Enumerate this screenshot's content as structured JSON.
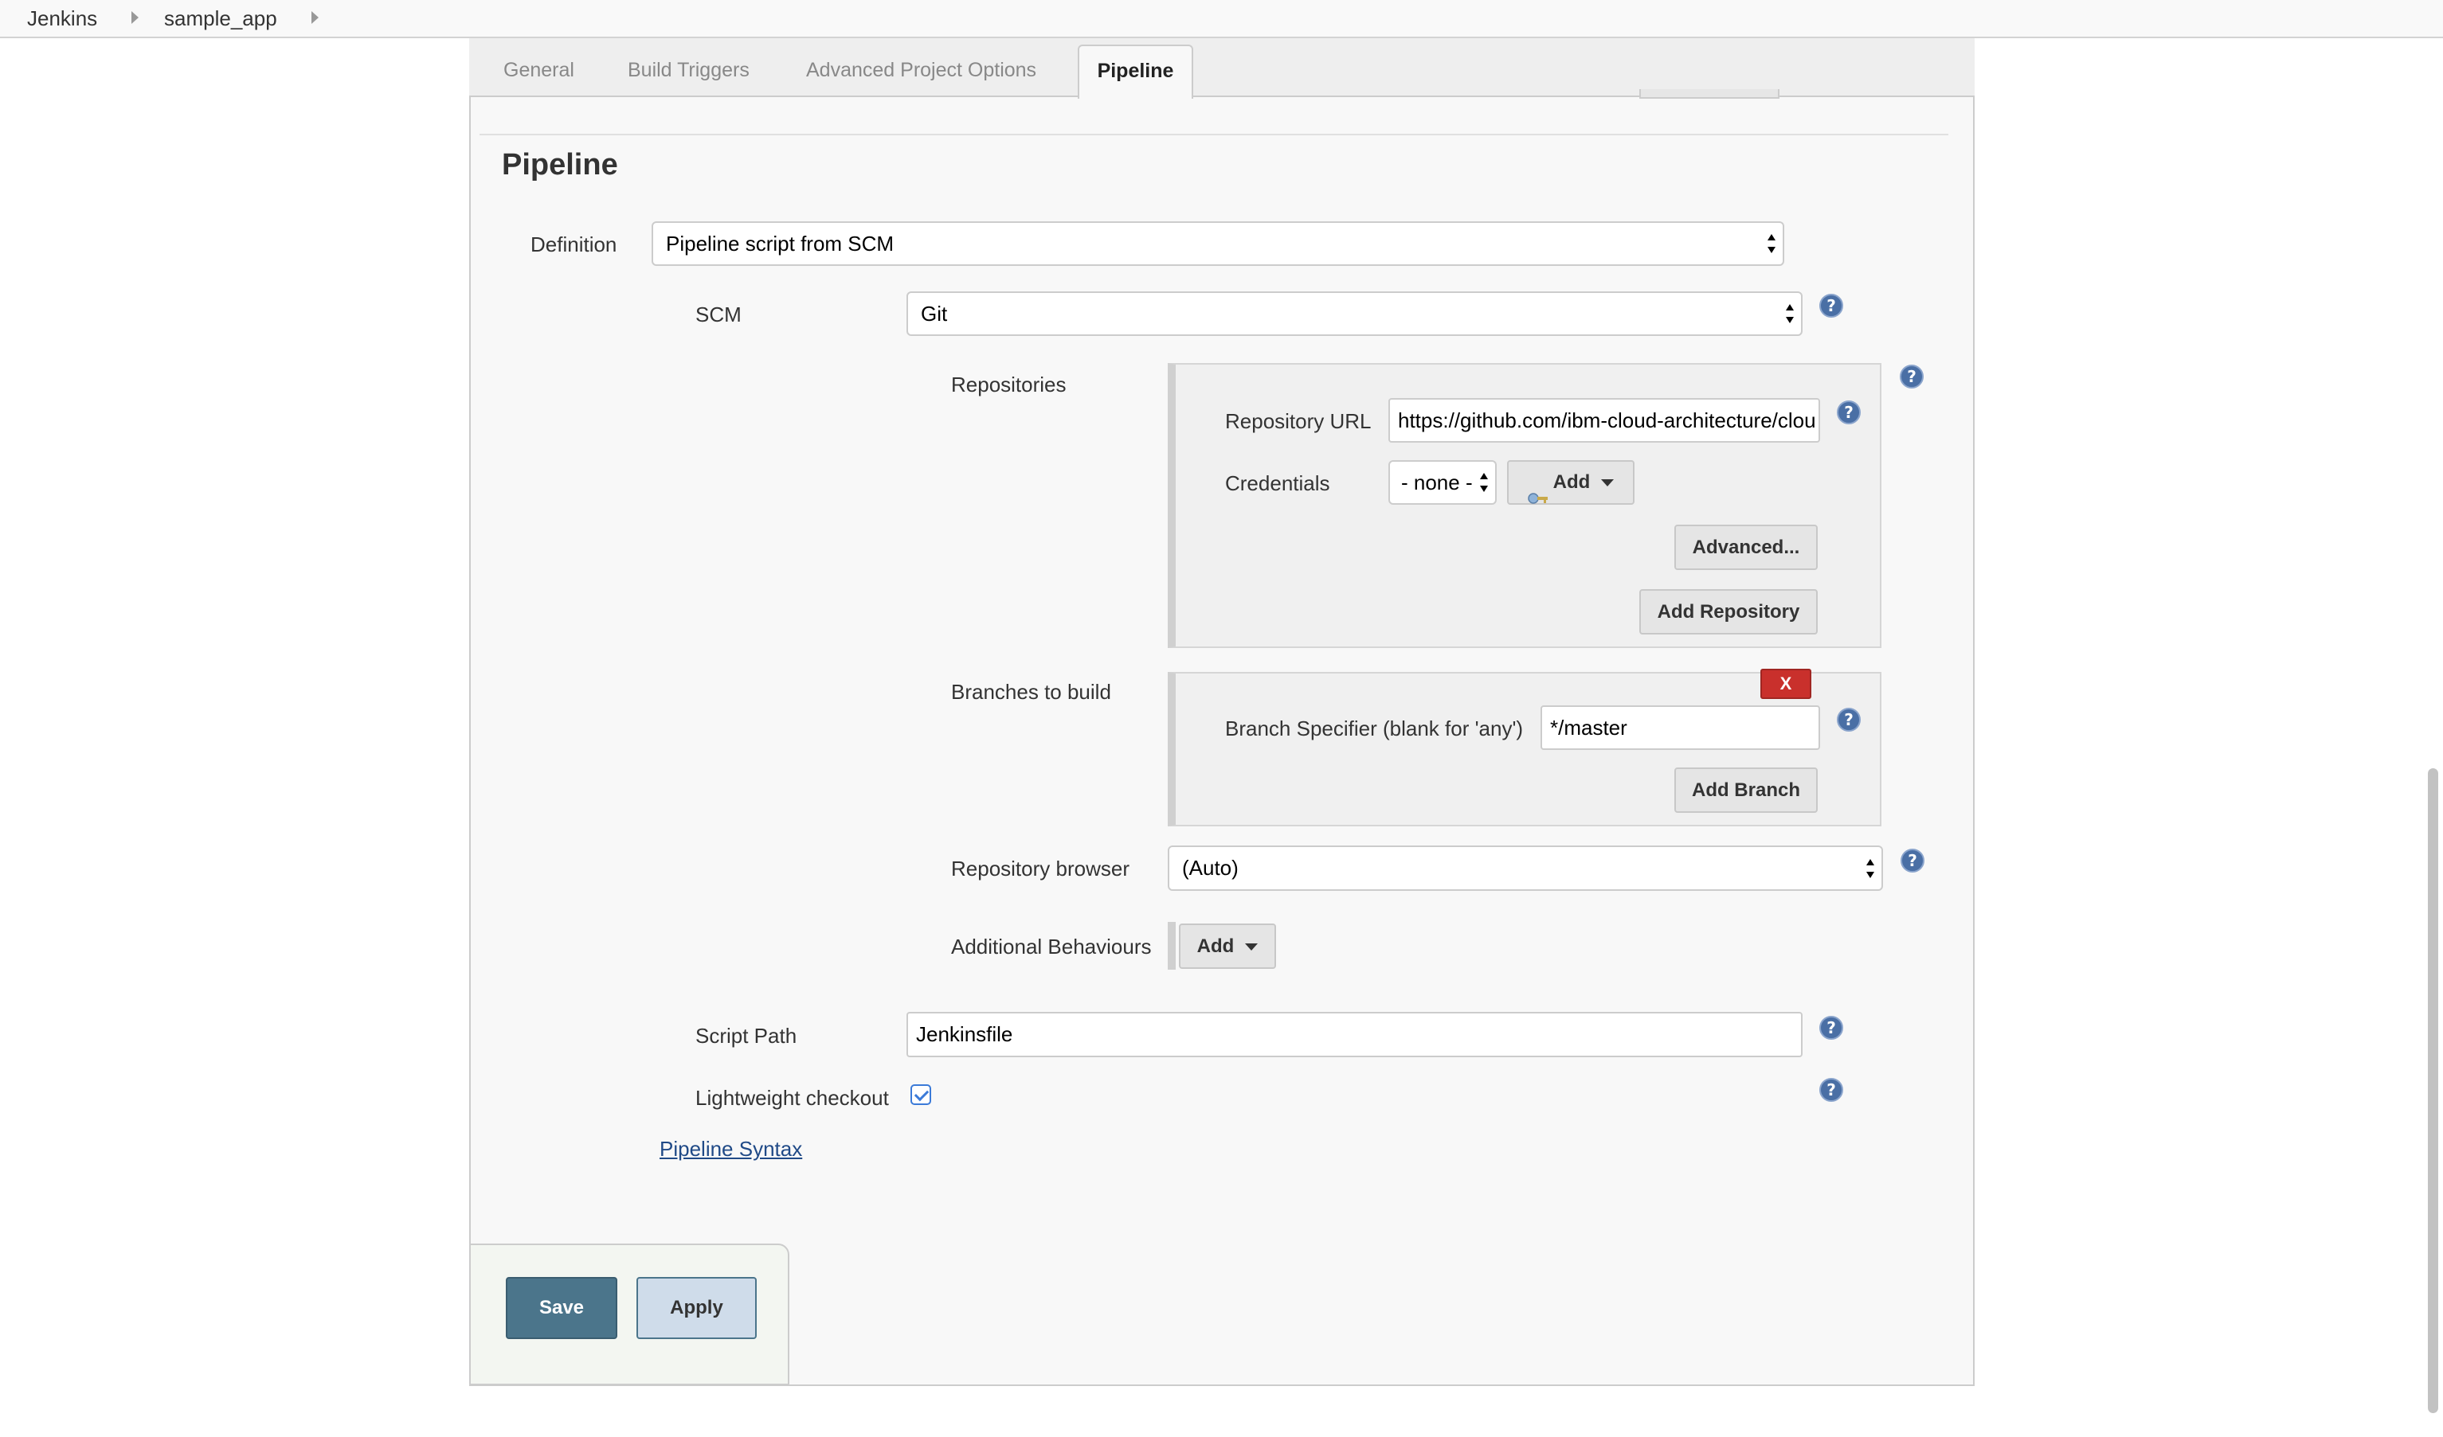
{
  "breadcrumb": {
    "items": [
      "Jenkins",
      "sample_app"
    ]
  },
  "tabs": [
    {
      "label": "General"
    },
    {
      "label": "Build Triggers"
    },
    {
      "label": "Advanced Project Options"
    },
    {
      "label": "Pipeline"
    }
  ],
  "pipeline": {
    "heading": "Pipeline",
    "definition_label": "Definition",
    "definition_value": "Pipeline script from SCM",
    "scm_label": "SCM",
    "scm_value": "Git",
    "repositories_label": "Repositories",
    "repository_url_label": "Repository URL",
    "repository_url_value": "https://github.com/ibm-cloud-architecture/clou",
    "credentials_label": "Credentials",
    "credentials_value": "- none -",
    "add_credentials_label": "Add",
    "advanced_button": "Advanced...",
    "add_repository_button": "Add Repository",
    "branches_label": "Branches to build",
    "delete_branch_label": "X",
    "branch_specifier_label": "Branch Specifier (blank for 'any')",
    "branch_specifier_value": "*/master",
    "add_branch_button": "Add Branch",
    "repository_browser_label": "Repository browser",
    "repository_browser_value": "(Auto)",
    "additional_behaviours_label": "Additional Behaviours",
    "add_behaviour_button": "Add",
    "script_path_label": "Script Path",
    "script_path_value": "Jenkinsfile",
    "lightweight_label": "Lightweight checkout",
    "lightweight_checked": true,
    "syntax_link": "Pipeline Syntax"
  },
  "actions": {
    "save": "Save",
    "apply": "Apply"
  },
  "icons": {
    "help": "?"
  },
  "colors": {
    "save_bg": "#4b758b",
    "delete_bg": "#c9302c",
    "help_bg": "#4a6fa5",
    "link": "#204a87"
  }
}
